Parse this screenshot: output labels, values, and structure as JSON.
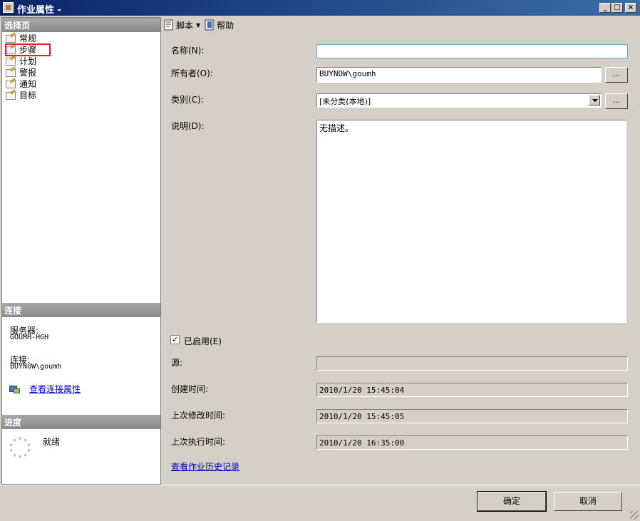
{
  "window": {
    "title": "作业属性 - ",
    "minimize": "_",
    "maximize": "□",
    "close": "×"
  },
  "left_panel": {
    "select_page_header": "选择页",
    "pages": [
      {
        "label": "常规",
        "icon": "page-wrench-icon"
      },
      {
        "label": "步骤",
        "icon": "page-wrench-icon"
      },
      {
        "label": "计划",
        "icon": "page-wrench-icon"
      },
      {
        "label": "警报",
        "icon": "page-wrench-icon"
      },
      {
        "label": "通知",
        "icon": "page-wrench-icon"
      },
      {
        "label": "目标",
        "icon": "page-wrench-icon"
      }
    ],
    "connection_header": "连接",
    "server_label": "服务器:",
    "server_value": "GOUMH-HGH",
    "connection_label": "连接:",
    "connection_value": "BUYNOW\\goumh",
    "view_connection_link": "查看连接属性",
    "progress_header": "进度",
    "progress_status": "就绪"
  },
  "toolbar": {
    "script_label": "脚本",
    "help_label": "帮助"
  },
  "form": {
    "name_label": "名称(N):",
    "name_value": "",
    "owner_label": "所有者(O):",
    "owner_value": "BUYNOW\\goumh",
    "owner_browse": "...",
    "category_label": "类别(C):",
    "category_value": "[未分类(本地)]",
    "category_browse": "...",
    "description_label": "说明(D):",
    "description_value": "无描述。",
    "enabled_label": "已启用(E)",
    "enabled_checked": true,
    "source_label": "源:",
    "source_value": "",
    "created_label": "创建时间:",
    "created_value": "2010/1/20  15:45:04",
    "modified_label": "上次修改时间:",
    "modified_value": "2010/1/20  15:45:05",
    "executed_label": "上次执行时间:",
    "executed_value": "2010/1/20  16:35:00",
    "history_link": "查看作业历史记录"
  },
  "buttons": {
    "ok": "确定",
    "cancel": "取消"
  }
}
